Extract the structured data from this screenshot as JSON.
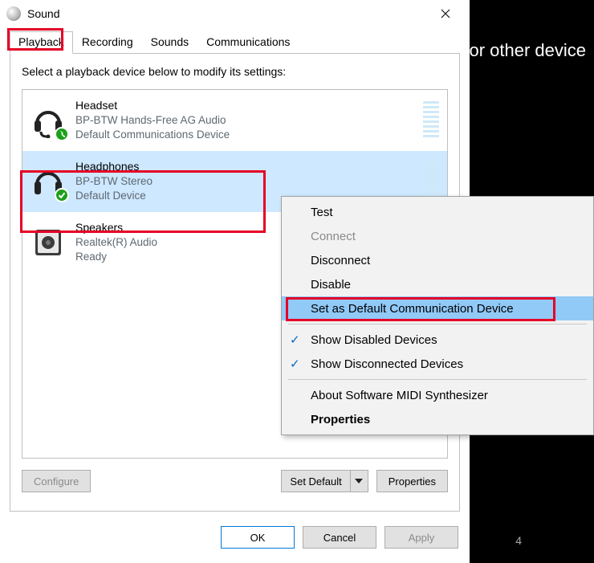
{
  "background": {
    "partial_text": "or other device",
    "corner_char": "4"
  },
  "titlebar": {
    "title": "Sound"
  },
  "tabs": [
    {
      "label": "Playback",
      "active": true
    },
    {
      "label": "Recording",
      "active": false
    },
    {
      "label": "Sounds",
      "active": false
    },
    {
      "label": "Communications",
      "active": false
    }
  ],
  "instruction": "Select a playback device below to modify its settings:",
  "devices": [
    {
      "name": "Headset",
      "sub": "BP-BTW Hands-Free AG Audio",
      "status": "Default Communications Device",
      "icon": "headset-phone",
      "selected": false
    },
    {
      "name": "Headphones",
      "sub": "BP-BTW Stereo",
      "status": "Default Device",
      "icon": "headphones-check",
      "selected": true
    },
    {
      "name": "Speakers",
      "sub": "Realtek(R) Audio",
      "status": "Ready",
      "icon": "speaker",
      "selected": false
    }
  ],
  "bottom_buttons": {
    "configure": "Configure",
    "set_default": "Set Default",
    "properties": "Properties"
  },
  "dialog_buttons": {
    "ok": "OK",
    "cancel": "Cancel",
    "apply": "Apply"
  },
  "context_menu": {
    "items": [
      {
        "label": "Test",
        "state": "enabled"
      },
      {
        "label": "Connect",
        "state": "disabled"
      },
      {
        "label": "Disconnect",
        "state": "enabled"
      },
      {
        "label": "Disable",
        "state": "enabled"
      },
      {
        "label": "Set as Default Communication Device",
        "state": "highlight"
      },
      {
        "sep": true
      },
      {
        "label": "Show Disabled Devices",
        "state": "checked"
      },
      {
        "label": "Show Disconnected Devices",
        "state": "checked"
      },
      {
        "sep": true
      },
      {
        "label": "About Software MIDI Synthesizer",
        "state": "enabled"
      },
      {
        "label": "Properties",
        "state": "bold"
      }
    ]
  }
}
